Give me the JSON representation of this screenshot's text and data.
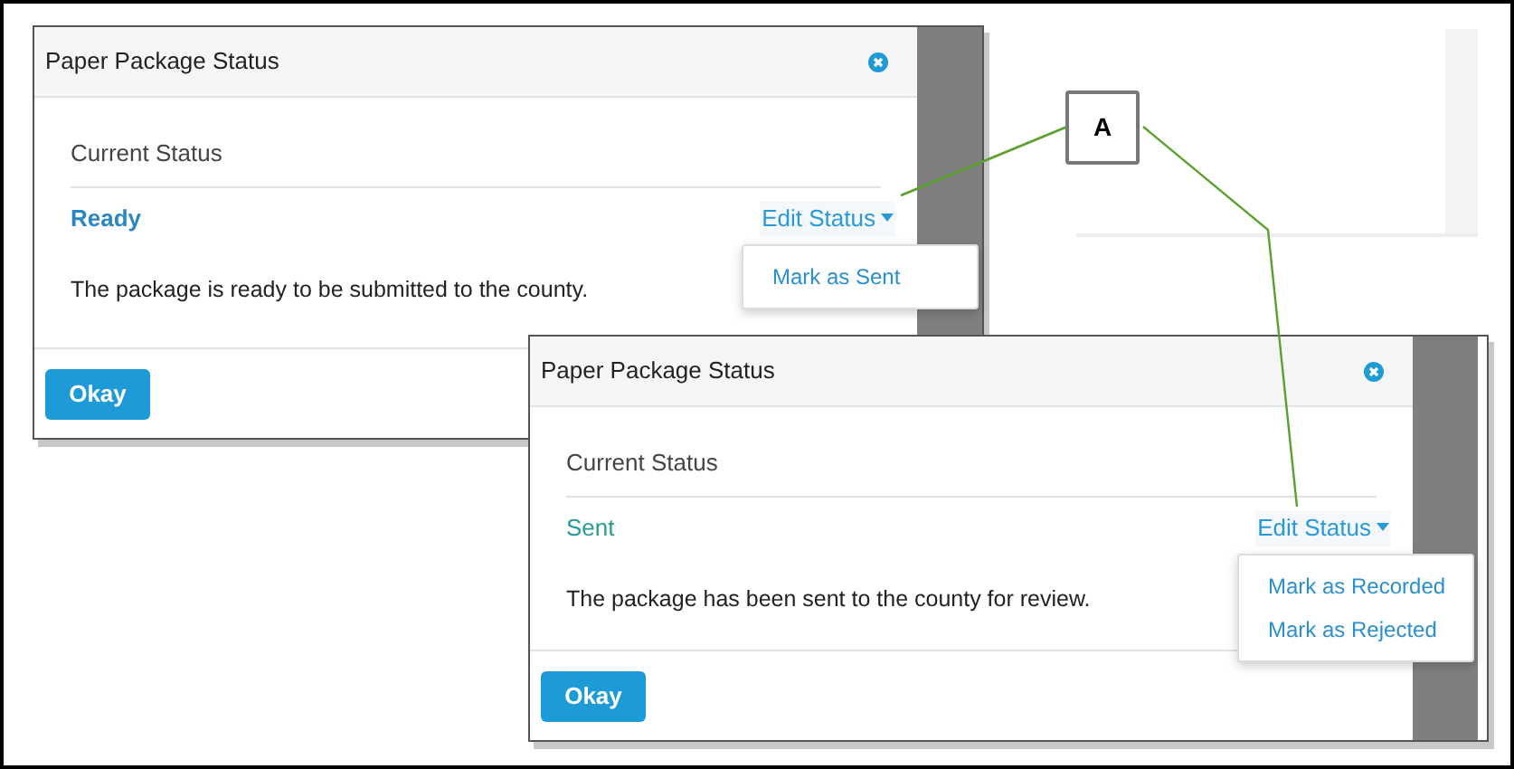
{
  "dialogs": [
    {
      "title": "Paper Package Status",
      "section_label": "Current Status",
      "status": "Ready",
      "color": "#2b87c0",
      "edit_label": "Edit Status",
      "menu_items": [
        "Mark as Sent"
      ],
      "description": "The package is ready to be submitted to the county.",
      "ok_label": "Okay"
    },
    {
      "title": "Paper Package Status",
      "section_label": "Current Status",
      "status": "Sent",
      "color": "#2a9a94",
      "edit_label": "Edit Status",
      "menu_items": [
        "Mark as Recorded",
        "Mark as Rejected"
      ],
      "description": "The package has been sent to the county for review.",
      "ok_label": "Okay"
    }
  ],
  "callout": {
    "label": "A"
  }
}
